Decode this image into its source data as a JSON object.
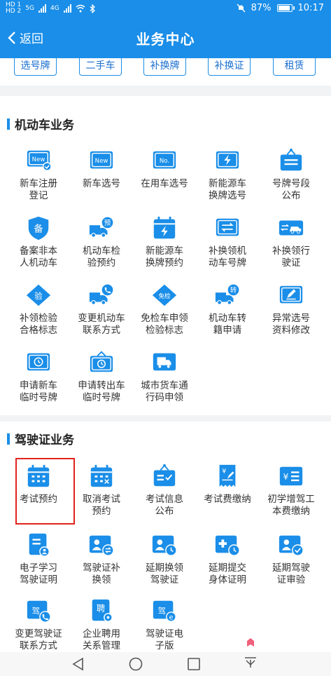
{
  "status_bar": {
    "left_badges": [
      "HD 1",
      "HD 2"
    ],
    "net1": "5G",
    "net2": "4G",
    "battery": "87%",
    "time": "10:17"
  },
  "header": {
    "back_label": "返回",
    "title": "业务中心"
  },
  "top_tags": [
    "选号牌",
    "二手车",
    "补换牌",
    "补换证",
    "租赁"
  ],
  "sections": [
    {
      "title": "机动车业务",
      "items": [
        {
          "label": "新车注册\n登记",
          "icon": "new-plate-check-icon"
        },
        {
          "label": "新车选号",
          "icon": "new-plate-icon"
        },
        {
          "label": "在用车选号",
          "icon": "plate-number-icon"
        },
        {
          "label": "新能源车\n换牌选号",
          "icon": "ev-plate-icon"
        },
        {
          "label": "号牌号段\n公布",
          "icon": "plate-board-icon"
        },
        {
          "label": "备案非本\n人机动车",
          "icon": "shield-register-icon"
        },
        {
          "label": "机动车检\n验预约",
          "icon": "truck-appointment-icon"
        },
        {
          "label": "新能源车\n换牌预约",
          "icon": "ev-calendar-icon"
        },
        {
          "label": "补换领机\n动车号牌",
          "icon": "plate-swap-icon"
        },
        {
          "label": "补换领行\n驶证",
          "icon": "license-car-swap-icon"
        },
        {
          "label": "补领检验\n合格标志",
          "icon": "inspection-diamond-icon"
        },
        {
          "label": "变更机动车\n联系方式",
          "icon": "truck-phone-icon"
        },
        {
          "label": "免检车申领\n检验标志",
          "icon": "exempt-diamond-icon"
        },
        {
          "label": "机动车转\n籍申请",
          "icon": "truck-transfer-icon"
        },
        {
          "label": "异常选号\n资料修改",
          "icon": "plate-edit-icon"
        },
        {
          "label": "申请新车\n临时号牌",
          "icon": "temp-plate-clock-icon"
        },
        {
          "label": "申请转出车\n临时号牌",
          "icon": "temp-plate-out-icon"
        },
        {
          "label": "城市货车通\n行码申领",
          "icon": "cargo-truck-icon"
        }
      ]
    },
    {
      "title": "驾驶证业务",
      "items": [
        {
          "label": "考试预约",
          "icon": "exam-calendar-icon"
        },
        {
          "label": "取消考试\n预约",
          "icon": "cancel-calendar-icon"
        },
        {
          "label": "考试信息\n公布",
          "icon": "exam-info-board-icon"
        },
        {
          "label": "考试费缴纳",
          "icon": "exam-fee-receipt-icon"
        },
        {
          "label": "初学增驾工\n本费缴纳",
          "icon": "yen-list-icon"
        },
        {
          "label": "电子学习\n驾驶证明",
          "icon": "e-study-doc-icon"
        },
        {
          "label": "驾驶证补\n换领",
          "icon": "license-swap-icon"
        },
        {
          "label": "延期换领\n驾驶证",
          "icon": "license-delay-icon"
        },
        {
          "label": "延期提交\n身体证明",
          "icon": "health-delay-icon"
        },
        {
          "label": "延期驾驶\n证审验",
          "icon": "license-verify-icon"
        },
        {
          "label": "变更驾驶证\n联系方式",
          "icon": "license-phone-icon"
        },
        {
          "label": "企业聘用\n关系管理",
          "icon": "hire-doc-icon"
        },
        {
          "label": "驾驶证电\n子版",
          "icon": "e-license-icon"
        }
      ]
    }
  ],
  "icon_glyphs": {
    "new_text": "New",
    "no_text": "No.",
    "bei": "备",
    "yu": "预",
    "yan": "验",
    "mianjian": "免检",
    "zhuan": "转",
    "jia": "驾",
    "pin": "聘",
    "yen": "¥"
  },
  "colors": {
    "primary": "#1a8ee8",
    "highlight": "#e0231d"
  }
}
